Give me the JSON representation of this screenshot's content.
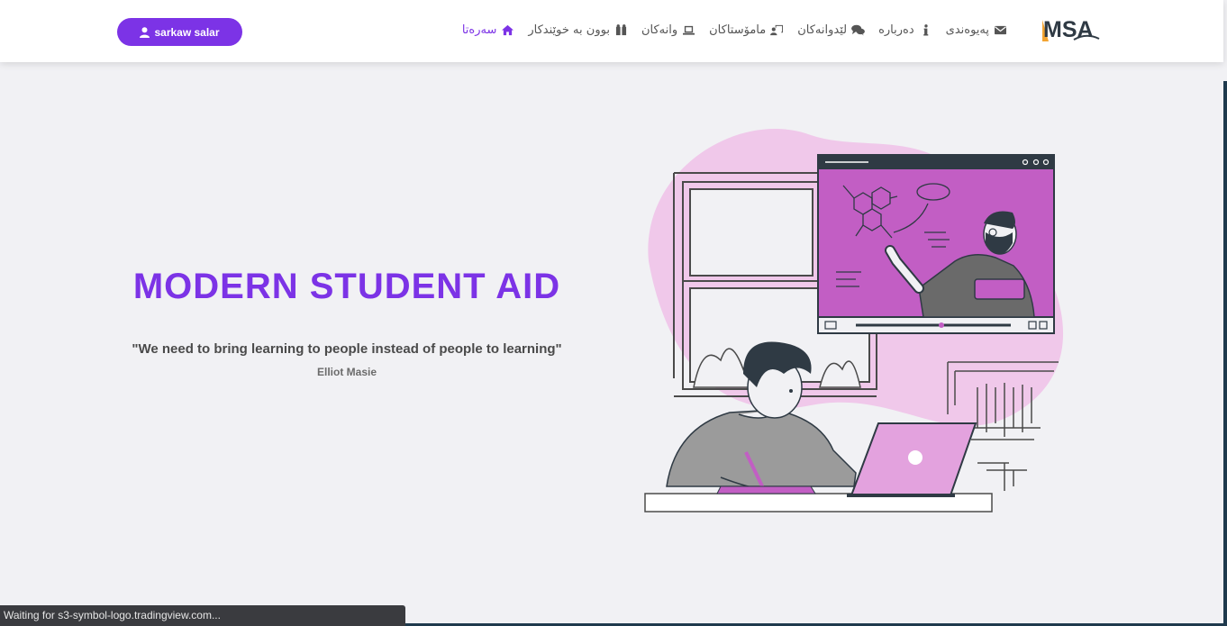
{
  "header": {
    "logo_text": "MSA",
    "user_button": "sarkaw salar",
    "nav": [
      {
        "label": "سەرەتا",
        "icon": "home-icon",
        "active": true
      },
      {
        "label": "بوون بە خوێندکار",
        "icon": "users-icon",
        "active": false
      },
      {
        "label": "وانەکان",
        "icon": "laptop-icon",
        "active": false
      },
      {
        "label": "مامۆستاکان",
        "icon": "chalkboard-teacher-icon",
        "active": false
      },
      {
        "label": "لێدوانەکان",
        "icon": "comments-icon",
        "active": false
      },
      {
        "label": "دەربارە",
        "icon": "info-icon",
        "active": false
      },
      {
        "label": "پەیوەندی",
        "icon": "envelope-icon",
        "active": false
      }
    ]
  },
  "hero": {
    "title": "MODERN STUDENT AID",
    "quote": "\"We need to bring learning to people instead of people to learning\"",
    "author": "Elliot Masie"
  },
  "status_bar": {
    "text": "Waiting for s3-symbol-logo.tradingview.com..."
  },
  "colors": {
    "accent": "#7c33e6",
    "illustration_pink": "#f0c8ea",
    "illustration_purple": "#c25ec4"
  }
}
